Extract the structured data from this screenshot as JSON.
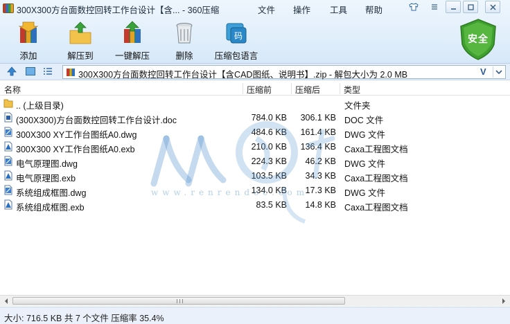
{
  "window": {
    "title": "300X300方台面数控回转工作台设计【含... - 360压缩"
  },
  "menu": {
    "file": "文件",
    "actions": "操作",
    "tools": "工具",
    "help": "帮助"
  },
  "toolbar": {
    "add": "添加",
    "extract_to": "解压到",
    "one_click_extract": "一键解压",
    "delete": "删除",
    "language": "压缩包语言",
    "language_icon_text": "码"
  },
  "security_badge": "安全",
  "address": {
    "path": "300X300方台面数控回转工作台设计【含CAD图纸、说明书】.zip - 解包大小为 2.0 MB",
    "v_mark": "V"
  },
  "columns": {
    "name": "名称",
    "size": "压缩前",
    "packed": "压缩后",
    "type": "类型"
  },
  "files": [
    {
      "name": ".. (上级目录)",
      "size": "",
      "packed": "",
      "type": "文件夹",
      "icon": "folder-icon"
    },
    {
      "name": "(300X300)方台面数控回转工作台设计.doc",
      "size": "784.0 KB",
      "packed": "306.1 KB",
      "type": "DOC 文件",
      "icon": "doc-file-icon"
    },
    {
      "name": "300X300 XY工作台图纸A0.dwg",
      "size": "484.6 KB",
      "packed": "161.4 KB",
      "type": "DWG 文件",
      "icon": "dwg-file-icon"
    },
    {
      "name": "300X300 XY工作台图纸A0.exb",
      "size": "210.0 KB",
      "packed": "136.4 KB",
      "type": "Caxa工程图文档",
      "icon": "exb-file-icon"
    },
    {
      "name": "电气原理图.dwg",
      "size": "224.3 KB",
      "packed": "46.2 KB",
      "type": "DWG 文件",
      "icon": "dwg-file-icon"
    },
    {
      "name": "电气原理图.exb",
      "size": "103.5 KB",
      "packed": "34.3 KB",
      "type": "Caxa工程图文档",
      "icon": "exb-file-icon"
    },
    {
      "name": "系统组成框图.dwg",
      "size": "134.0 KB",
      "packed": "17.3 KB",
      "type": "DWG 文件",
      "icon": "dwg-file-icon"
    },
    {
      "name": "系统组成框图.exb",
      "size": "83.5 KB",
      "packed": "14.8 KB",
      "type": "Caxa工程图文档",
      "icon": "exb-file-icon"
    }
  ],
  "status": {
    "summary": "大小: 716.5 KB 共 7 个文件 压缩率 35.4%"
  },
  "watermark": {
    "url": "www.renrendoc.com"
  }
}
